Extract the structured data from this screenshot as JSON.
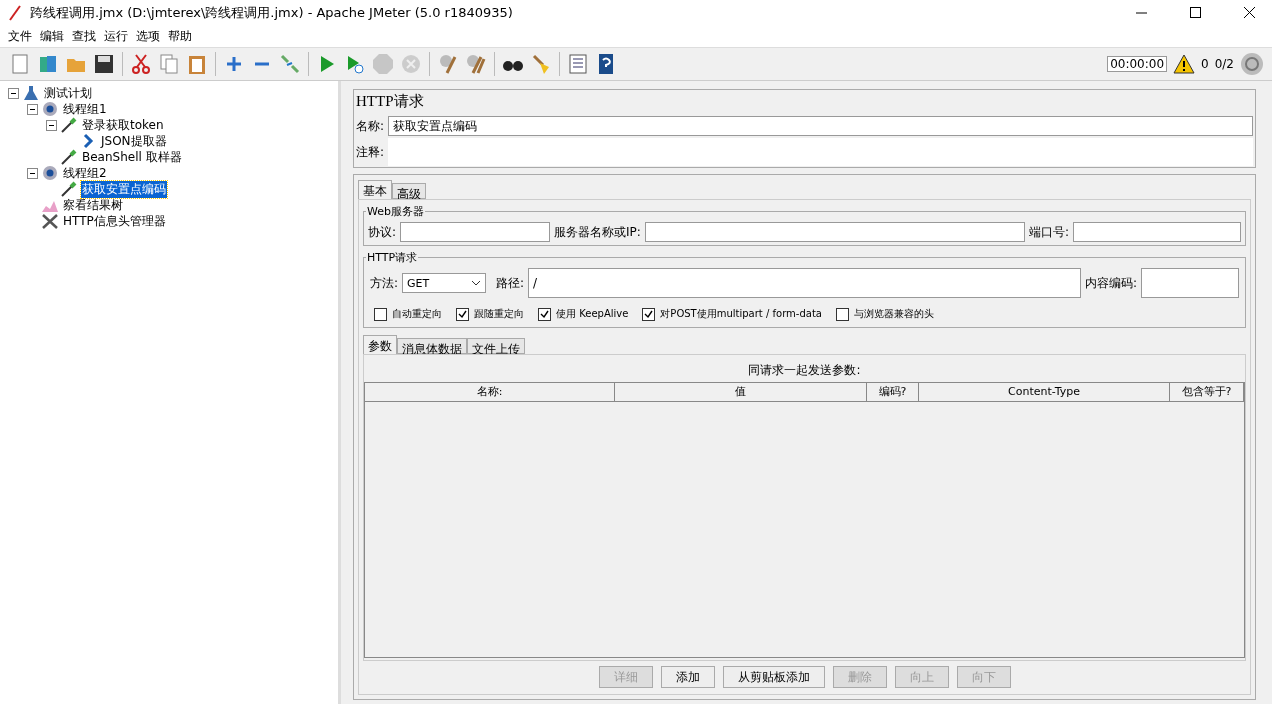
{
  "window": {
    "title": "跨线程调用.jmx (D:\\jmterex\\跨线程调用.jmx) - Apache JMeter (5.0 r1840935)"
  },
  "menu": [
    "文件",
    "编辑",
    "查找",
    "运行",
    "选项",
    "帮助"
  ],
  "toolbar": [
    [
      {
        "kind": "new",
        "disabled": false
      },
      {
        "kind": "templates",
        "disabled": false
      },
      {
        "kind": "open",
        "disabled": false
      },
      {
        "kind": "save",
        "disabled": false
      }
    ],
    [
      {
        "kind": "cut",
        "disabled": false
      },
      {
        "kind": "copy",
        "disabled": false
      },
      {
        "kind": "paste",
        "disabled": false
      }
    ],
    [
      {
        "kind": "expand",
        "disabled": false
      },
      {
        "kind": "collapse",
        "disabled": false
      },
      {
        "kind": "toggle",
        "disabled": false
      }
    ],
    [
      {
        "kind": "start",
        "disabled": false
      },
      {
        "kind": "start-nopause",
        "disabled": false
      },
      {
        "kind": "stop",
        "disabled": true
      },
      {
        "kind": "shutdown",
        "disabled": true
      }
    ],
    [
      {
        "kind": "clear",
        "disabled": false
      },
      {
        "kind": "clear-all",
        "disabled": false
      }
    ],
    [
      {
        "kind": "search",
        "disabled": false
      },
      {
        "kind": "reset",
        "disabled": false
      }
    ],
    [
      {
        "kind": "functions",
        "disabled": false
      },
      {
        "kind": "help",
        "disabled": false
      }
    ]
  ],
  "status": {
    "timer": "00:00:00",
    "warnings": "0",
    "threads": "0/2"
  },
  "tree": [
    {
      "label": "测试计划",
      "kind": "plan",
      "selected": false,
      "expanded": true,
      "children": [
        {
          "label": "线程组1",
          "kind": "group",
          "selected": false,
          "expanded": true,
          "children": [
            {
              "label": "登录获取token",
              "kind": "sampler",
              "selected": false,
              "expanded": true,
              "children": [
                {
                  "label": "JSON提取器",
                  "kind": "extractor",
                  "selected": false
                }
              ]
            },
            {
              "label": "BeanShell 取样器",
              "kind": "sampler",
              "selected": false
            }
          ]
        },
        {
          "label": "线程组2",
          "kind": "group",
          "selected": false,
          "expanded": true,
          "children": [
            {
              "label": "获取安置点编码",
              "kind": "sampler",
              "selected": true
            }
          ]
        },
        {
          "label": "察看结果树",
          "kind": "listener",
          "selected": false
        },
        {
          "label": "HTTP信息头管理器",
          "kind": "config",
          "selected": false
        }
      ]
    }
  ],
  "panel": {
    "title": "HTTP请求",
    "name_label": "名称:",
    "name_value": "获取安置点编码",
    "comment_label": "注释:"
  },
  "tabs": [
    {
      "label": "基本",
      "selected": true
    },
    {
      "label": "高级",
      "selected": false
    }
  ],
  "web_server": {
    "legend": "Web服务器",
    "protocol_label": "协议:",
    "server_label": "服务器名称或IP:",
    "port_label": "端口号:"
  },
  "http_request": {
    "legend": "HTTP请求",
    "method_label": "方法:",
    "method": "GET",
    "path_label": "路径:",
    "path": "/",
    "encoding_label": "内容编码:"
  },
  "options": [
    {
      "label": "自动重定向",
      "checked": false
    },
    {
      "label": "跟随重定向",
      "checked": true
    },
    {
      "label": "使用 KeepAlive",
      "checked": true
    },
    {
      "label": "对POST使用multipart / form-data",
      "checked": true
    },
    {
      "label": "与浏览器兼容的头",
      "checked": false
    }
  ],
  "sub_tabs": [
    {
      "label": "参数",
      "selected": true
    },
    {
      "label": "消息体数据",
      "selected": false
    },
    {
      "label": "文件上传",
      "selected": false
    }
  ],
  "table": {
    "caption": "同请求一起发送参数:",
    "columns": [
      "名称:",
      "值",
      "编码?",
      "Content-Type",
      "包含等于?"
    ]
  },
  "buttons": [
    {
      "label": "详细",
      "disabled": true
    },
    {
      "label": "添加",
      "disabled": false
    },
    {
      "label": "从剪贴板添加",
      "disabled": false
    },
    {
      "label": "删除",
      "disabled": true
    },
    {
      "label": "向上",
      "disabled": true
    },
    {
      "label": "向下",
      "disabled": true
    }
  ]
}
